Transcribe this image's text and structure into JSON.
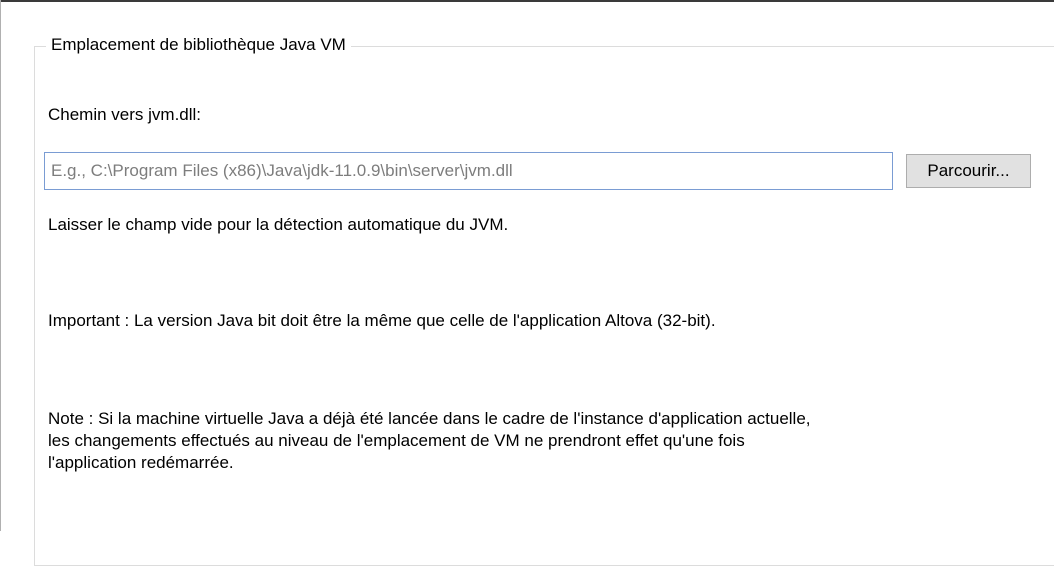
{
  "groupbox": {
    "title": "Emplacement de bibliothèque Java VM"
  },
  "jvm_path": {
    "label": "Chemin vers jvm.dll:",
    "value": "",
    "placeholder": "E.g., C:\\Program Files (x86)\\Java\\jdk-11.0.9\\bin\\server\\jvm.dll",
    "browse_label": "Parcourir..."
  },
  "hints": {
    "auto_detect": "Laisser le champ vide pour la détection automatique du JVM.",
    "important": "Important : La version Java bit doit être la même que celle de l'application Altova (32-bit).",
    "note_line1": "Note : Si la machine virtuelle Java a déjà été lancée dans le cadre de l'instance d'application actuelle,",
    "note_line2": "les changements effectués au niveau de l'emplacement de VM ne prendront effet qu'une fois",
    "note_line3": "l'application redémarrée."
  },
  "colors": {
    "input_border_focus": "#7a9cd3",
    "placeholder_text": "#7d7d7d",
    "button_face": "#e1e1e1",
    "groupbox_border": "#dcdcdc"
  }
}
